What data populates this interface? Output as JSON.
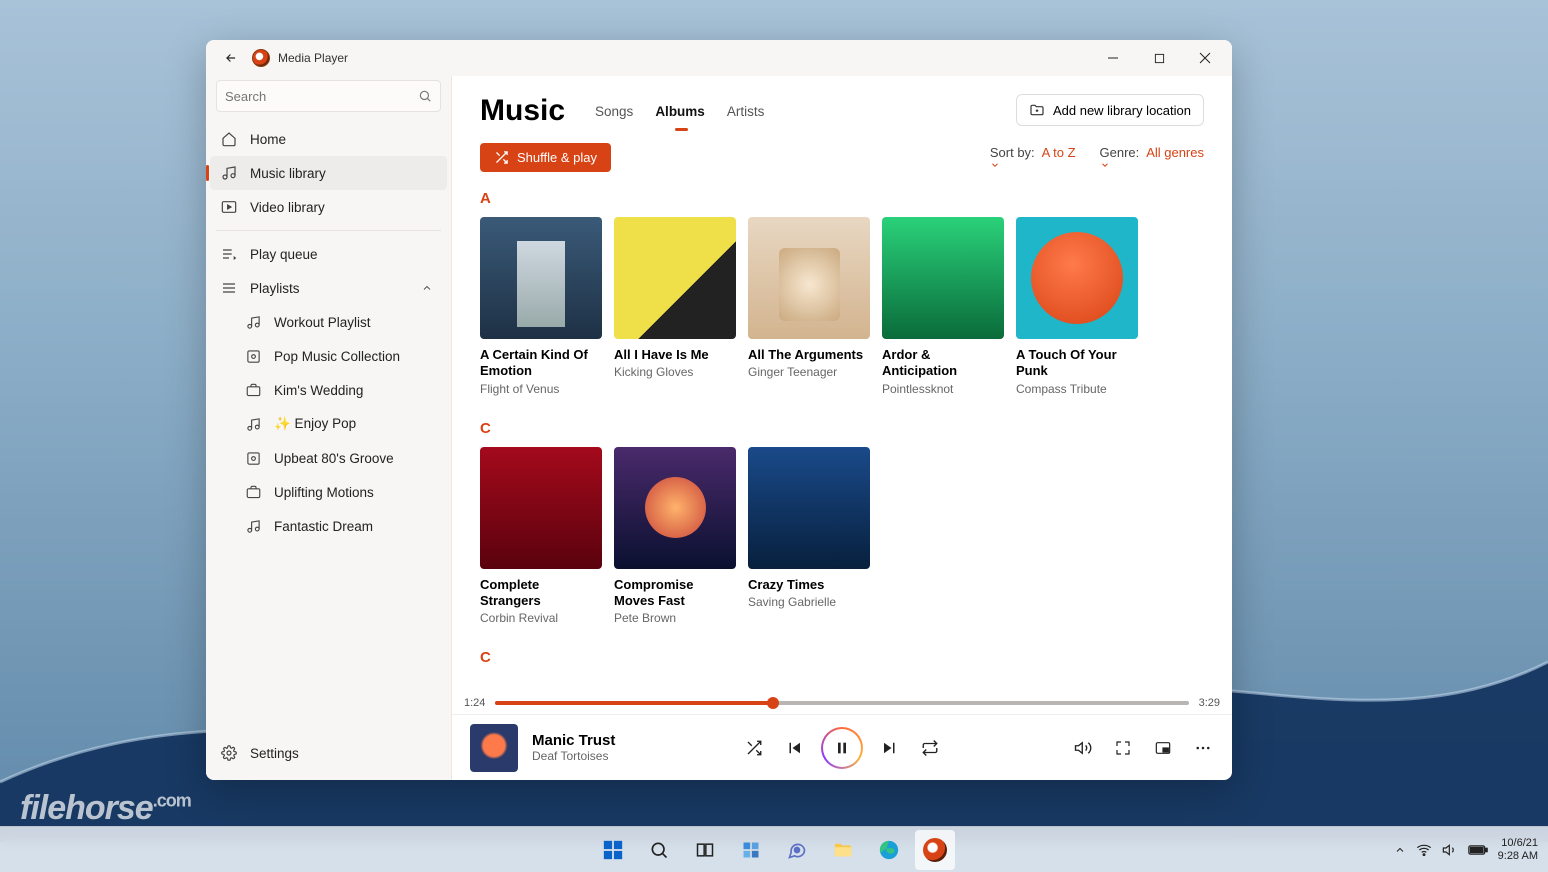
{
  "taskbar": {
    "date": "10/6/21",
    "time": "9:28 AM"
  },
  "watermark": {
    "brand": "filehorse",
    "tld": ".com"
  },
  "titlebar": {
    "app_name": "Media Player"
  },
  "sidebar": {
    "search_placeholder": "Search",
    "nav": [
      {
        "label": "Home",
        "active": false
      },
      {
        "label": "Music library",
        "active": true
      },
      {
        "label": "Video library",
        "active": false
      }
    ],
    "play_queue": "Play queue",
    "playlists_label": "Playlists",
    "playlists": [
      "Workout Playlist",
      "Pop Music Collection",
      "Kim's Wedding",
      "✨ Enjoy Pop",
      "Upbeat 80's Groove",
      "Uplifting Motions",
      "Fantastic Dream"
    ],
    "settings": "Settings"
  },
  "header": {
    "title": "Music",
    "tabs": [
      "Songs",
      "Albums",
      "Artists"
    ],
    "active_tab": 1,
    "add_library": "Add new library location"
  },
  "actions": {
    "shuffle": "Shuffle & play",
    "sort_label": "Sort by:",
    "sort_value": "A to Z",
    "genre_label": "Genre:",
    "genre_value": "All genres"
  },
  "sections": [
    {
      "letter": "A",
      "albums": [
        {
          "title": "A Certain Kind Of Emotion",
          "artist": "Flight of Venus",
          "art": "a1"
        },
        {
          "title": "All I Have Is Me",
          "artist": "Kicking Gloves",
          "art": "a2"
        },
        {
          "title": "All The Arguments",
          "artist": "Ginger Teenager",
          "art": "a3"
        },
        {
          "title": "Ardor & Anticipation",
          "artist": "Pointlessknot",
          "art": "a4"
        },
        {
          "title": "A Touch Of Your Punk",
          "artist": "Compass Tribute",
          "art": "a5"
        }
      ]
    },
    {
      "letter": "C",
      "albums": [
        {
          "title": "Complete Strangers",
          "artist": "Corbin Revival",
          "art": "c1"
        },
        {
          "title": "Compromise Moves Fast",
          "artist": "Pete Brown",
          "art": "c2"
        },
        {
          "title": "Crazy Times",
          "artist": "Saving Gabrielle",
          "art": "c3"
        }
      ]
    },
    {
      "letter": "C",
      "albums": []
    }
  ],
  "player": {
    "elapsed": "1:24",
    "total": "3:29",
    "progress_pct": 40,
    "title": "Manic Trust",
    "artist": "Deaf Tortoises"
  }
}
